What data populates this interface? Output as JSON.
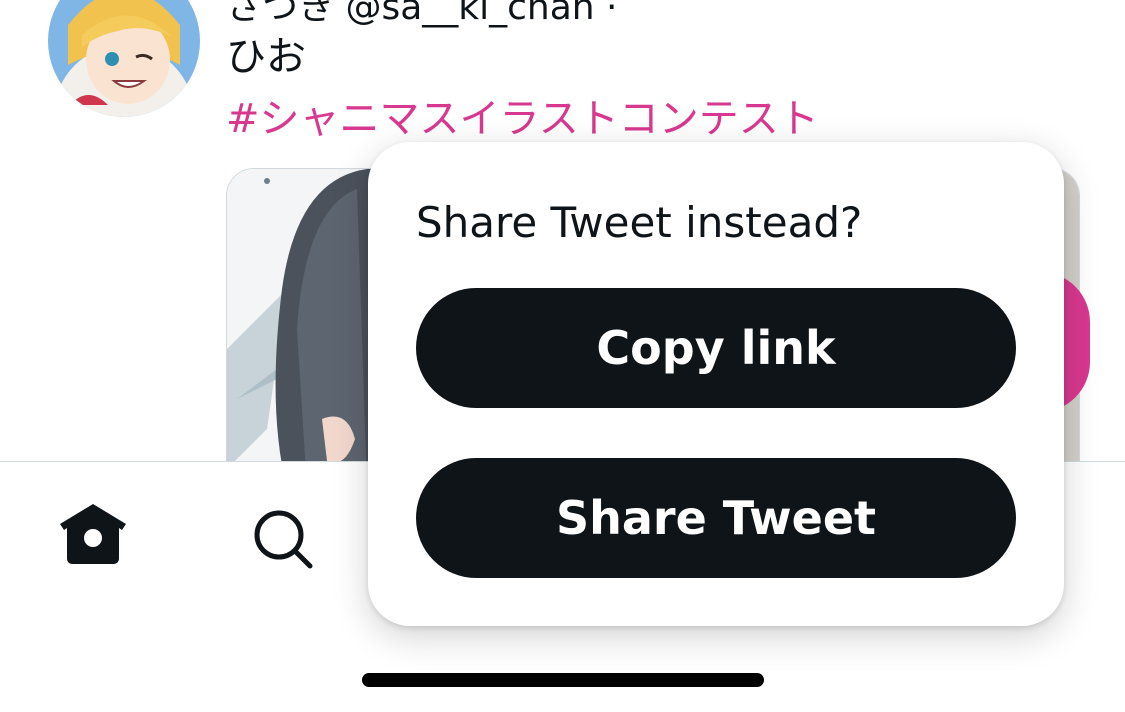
{
  "tweet": {
    "author_partial": "さつき @sa__ki_chan ·",
    "text": "ひお",
    "hashtag": "#シャニマスイラストコンテスト"
  },
  "dialog": {
    "title": "Share Tweet instead?",
    "copy_link_label": "Copy link",
    "share_tweet_label": "Share Tweet"
  },
  "tabbar": {
    "icons": [
      "home-icon",
      "search-icon"
    ]
  },
  "colors": {
    "hashtag": "#d8388f",
    "button_bg": "#0f1419",
    "button_text": "#ffffff",
    "fab": "#d8388f"
  }
}
